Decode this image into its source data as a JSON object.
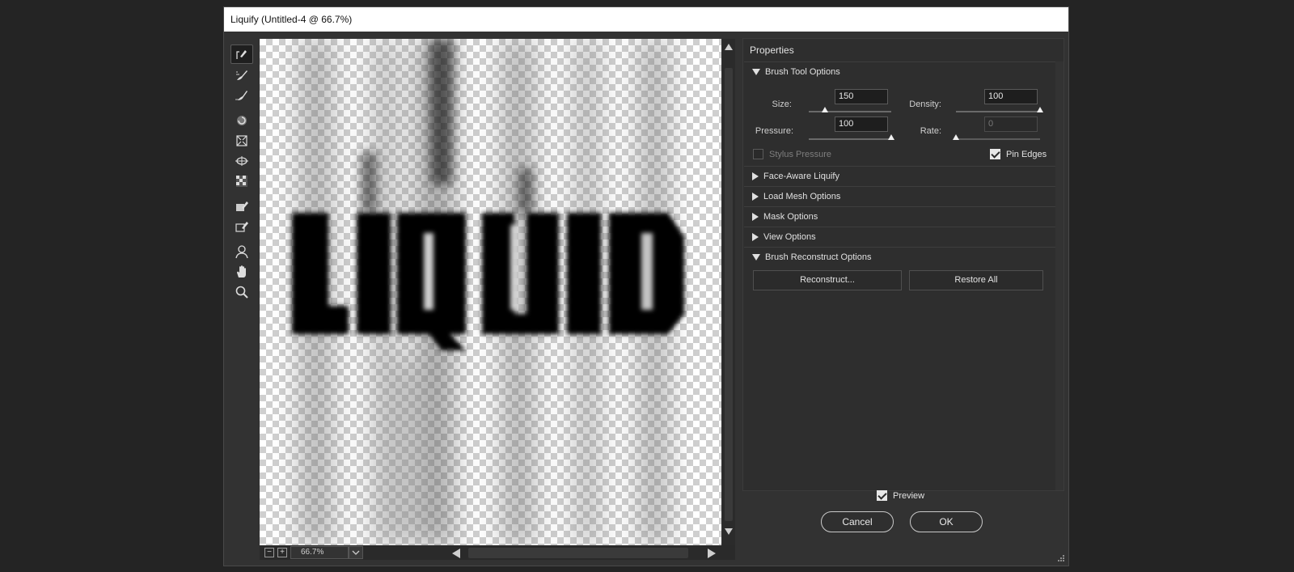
{
  "window": {
    "title": "Liquify (Untitled-4 @ 66.7%)"
  },
  "tools": [
    {
      "name": "forward-warp-tool",
      "active": true
    },
    {
      "name": "reconstruct-tool"
    },
    {
      "name": "smooth-tool"
    },
    {
      "name": "twirl-clockwise-tool"
    },
    {
      "name": "pucker-tool"
    },
    {
      "name": "bloat-tool"
    },
    {
      "name": "push-left-tool"
    },
    {
      "name": "freeze-mask-tool"
    },
    {
      "name": "thaw-mask-tool"
    },
    {
      "name": "face-tool"
    },
    {
      "name": "hand-tool"
    },
    {
      "name": "zoom-tool"
    }
  ],
  "canvas": {
    "text": "LIQUID"
  },
  "statusbar": {
    "zoom_out": "−",
    "zoom_in": "+",
    "zoom_value": "66.7%"
  },
  "properties": {
    "header": "Properties",
    "brush_tool_options": {
      "title": "Brush Tool Options",
      "size_label": "Size:",
      "size_value": "150",
      "size_level": 0.2,
      "density_label": "Density:",
      "density_value": "100",
      "density_level": 1.0,
      "pressure_label": "Pressure:",
      "pressure_value": "100",
      "pressure_level": 1.0,
      "rate_label": "Rate:",
      "rate_value": "0",
      "rate_level": 0.0,
      "stylus_pressure_label": "Stylus Pressure",
      "stylus_pressure_checked": false,
      "pin_edges_label": "Pin Edges",
      "pin_edges_checked": true
    },
    "sections": [
      {
        "title": "Face-Aware Liquify",
        "expanded": false
      },
      {
        "title": "Load Mesh Options",
        "expanded": false
      },
      {
        "title": "Mask Options",
        "expanded": false
      },
      {
        "title": "View Options",
        "expanded": false
      },
      {
        "title": "Brush Reconstruct Options",
        "expanded": true
      }
    ],
    "reconstruct_label": "Reconstruct...",
    "restore_all_label": "Restore All"
  },
  "footer": {
    "preview_label": "Preview",
    "preview_checked": true,
    "cancel_label": "Cancel",
    "ok_label": "OK"
  },
  "colors": {
    "dialog_bg": "#323232",
    "panel_bg": "#2e2e2e",
    "title_bg": "#ffffff"
  }
}
